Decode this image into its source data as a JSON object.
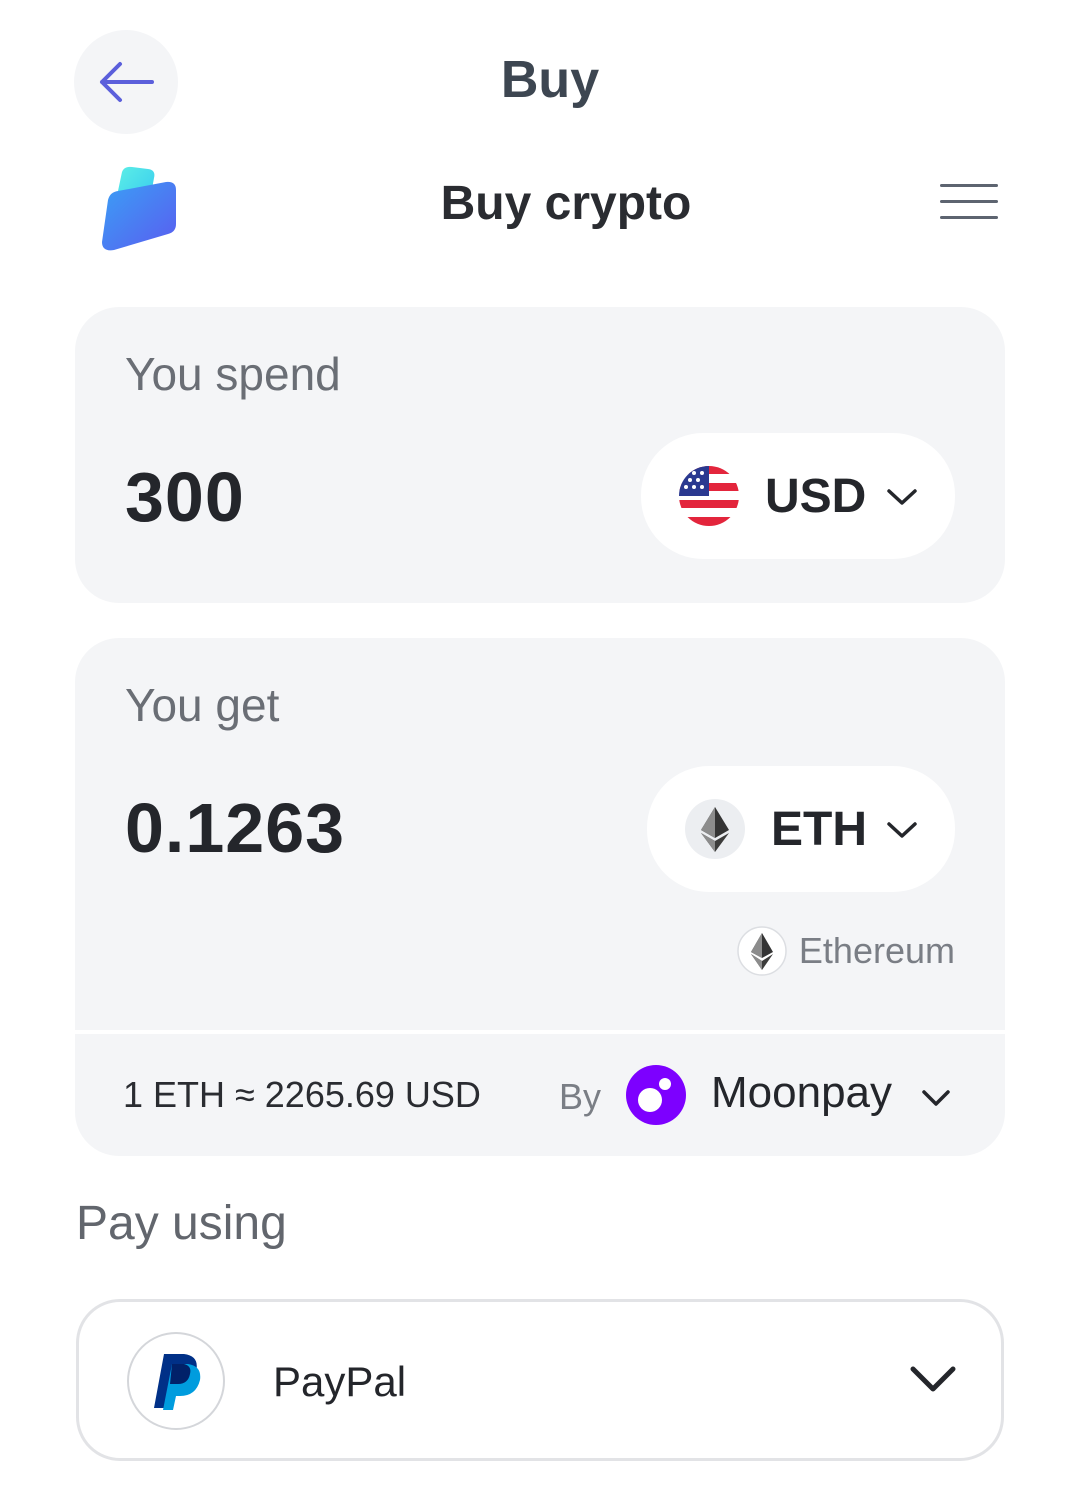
{
  "header": {
    "title": "Buy",
    "back_icon": "arrow-left-icon"
  },
  "widget": {
    "title": "Buy crypto",
    "logo_icon": "app-logo-icon",
    "menu_icon": "hamburger-menu-icon"
  },
  "spend": {
    "label": "You spend",
    "amount": "300",
    "currency": "USD",
    "currency_icon": "us-flag-icon"
  },
  "get": {
    "label": "You get",
    "amount": "0.1263",
    "currency": "ETH",
    "currency_icon": "ethereum-icon",
    "network": "Ethereum"
  },
  "rate": {
    "text": "1 ETH ≈ 2265.69 USD",
    "by_label": "By",
    "provider": "Moonpay",
    "provider_icon": "moonpay-icon"
  },
  "payment": {
    "section_label": "Pay using",
    "method": "PayPal",
    "method_icon": "paypal-icon"
  },
  "colors": {
    "accent": "#5b5fdb",
    "card_bg": "#f4f5f7",
    "moonpay": "#7d00ff",
    "paypal_dark": "#003087",
    "paypal_light": "#009cde"
  }
}
